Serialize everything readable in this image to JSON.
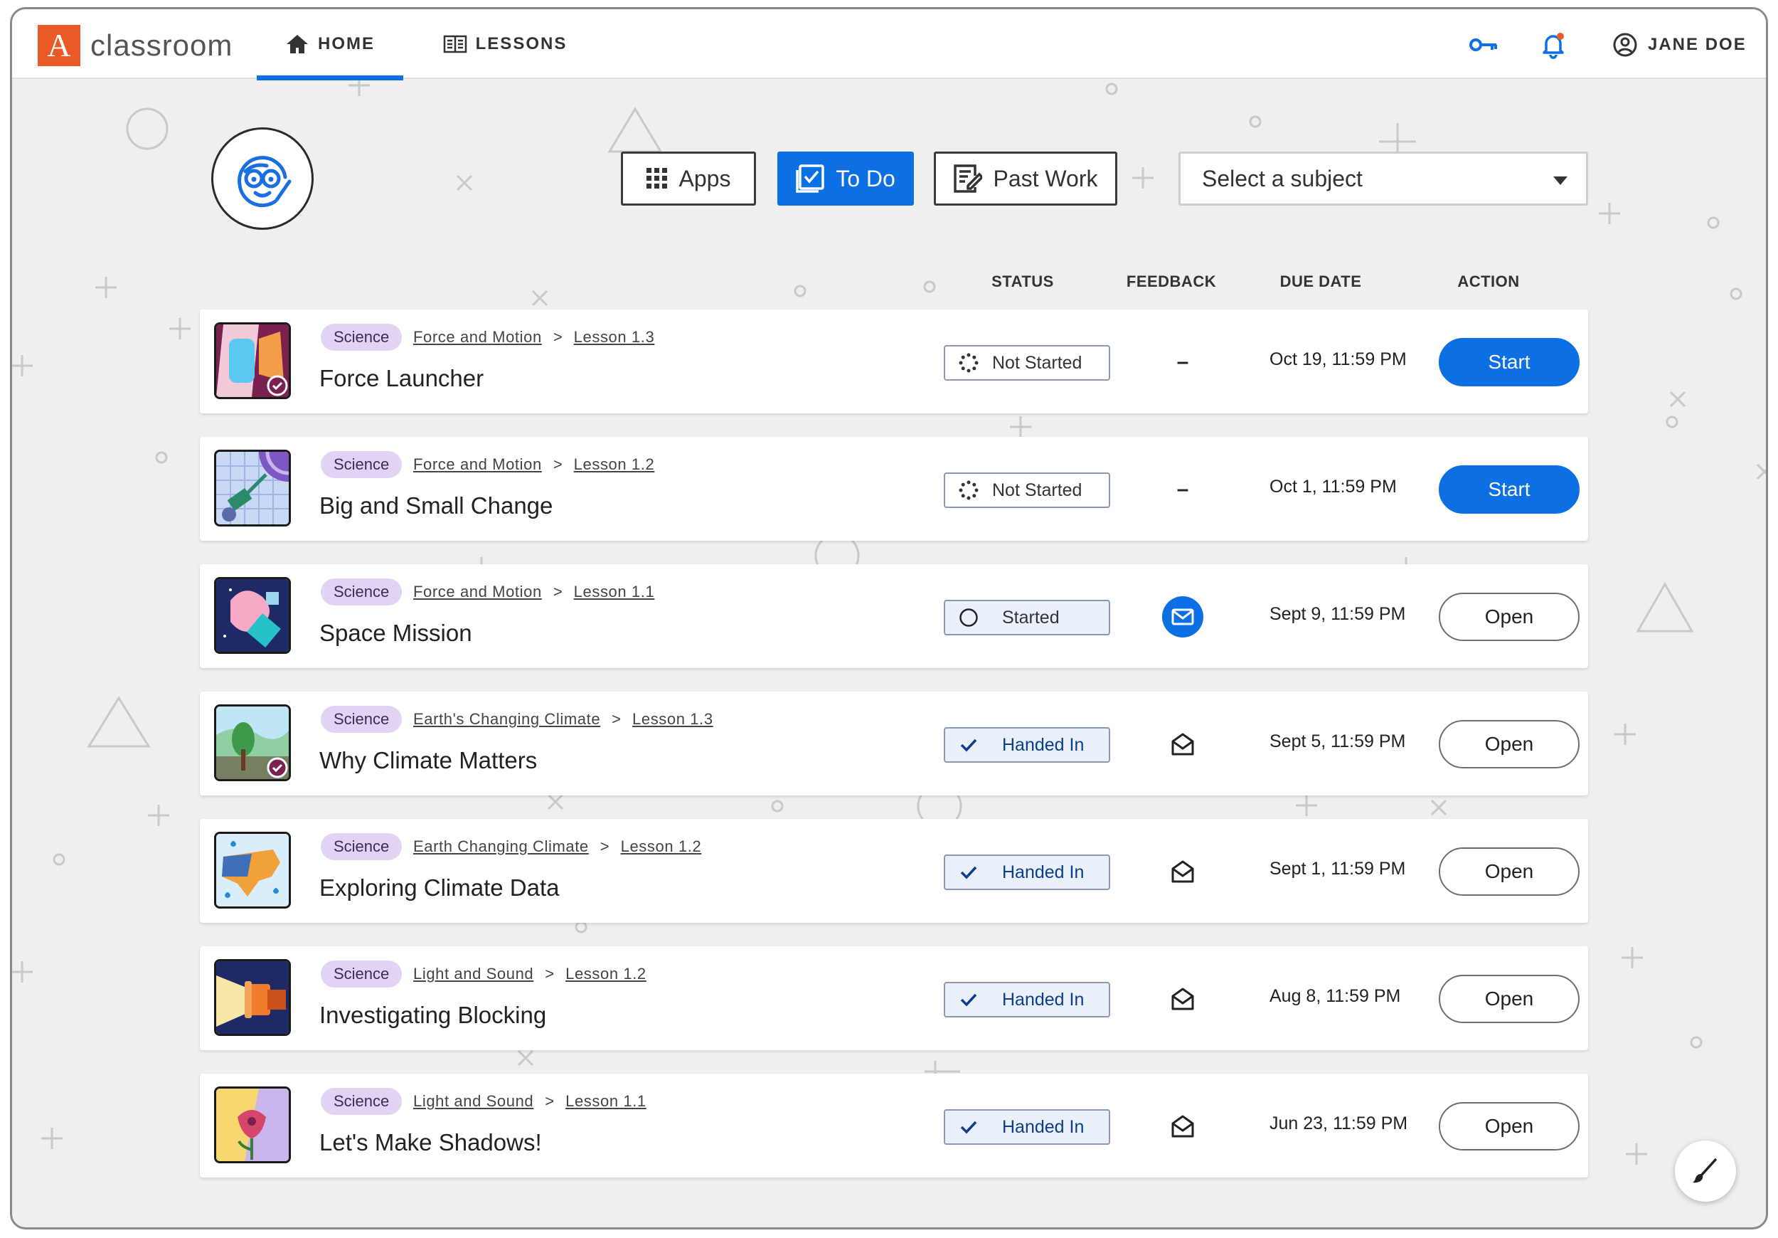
{
  "app": {
    "logo_letter": "A",
    "logo_text": "classroom",
    "brand_color": "#ea5a27",
    "accent_color": "#0c6fe3"
  },
  "nav": {
    "tabs": [
      {
        "label": "HOME",
        "icon": "home-icon",
        "active": true
      },
      {
        "label": "LESSONS",
        "icon": "book-icon",
        "active": false
      }
    ],
    "key_icon": "key-icon",
    "bell_icon": "bell-icon",
    "user_name": "JANE DOE"
  },
  "toolbar": {
    "apps_label": "Apps",
    "todo_label": "To Do",
    "past_work_label": "Past Work",
    "subject_placeholder": "Select a subject"
  },
  "columns": {
    "status": "STATUS",
    "feedback": "FEEDBACK",
    "due_date": "DUE DATE",
    "action": "ACTION"
  },
  "assignments": [
    {
      "subject": "Science",
      "unit": "Force and Motion",
      "lesson": "Lesson 1.3",
      "title": "Force Launcher",
      "status": "Not Started",
      "status_icon": "progress-dots-icon",
      "feedback": "–",
      "due": "Oct 19, 11:59 PM",
      "action": "Start"
    },
    {
      "subject": "Science",
      "unit": "Force and Motion",
      "lesson": "Lesson 1.2",
      "title": "Big and Small Change",
      "status": "Not Started",
      "status_icon": "progress-dots-icon",
      "feedback": "–",
      "due": "Oct 1, 11:59 PM",
      "action": "Start"
    },
    {
      "subject": "Science",
      "unit": "Force and Motion",
      "lesson": "Lesson 1.1",
      "title": "Space Mission",
      "status": "Started",
      "status_icon": "circle-icon",
      "feedback": "mail-new-icon",
      "due": "Sept 9, 11:59 PM",
      "action": "Open"
    },
    {
      "subject": "Science",
      "unit": "Earth's Changing Climate",
      "lesson": "Lesson 1.3",
      "title": "Why Climate Matters",
      "status": "Handed In",
      "status_icon": "check-icon",
      "feedback": "mail-open-icon",
      "due": "Sept 5, 11:59 PM",
      "action": "Open"
    },
    {
      "subject": "Science",
      "unit": "Earth Changing Climate",
      "lesson": "Lesson 1.2",
      "title": "Exploring Climate Data",
      "status": "Handed In",
      "status_icon": "check-icon",
      "feedback": "mail-open-icon",
      "due": "Sept 1, 11:59 PM",
      "action": "Open"
    },
    {
      "subject": "Science",
      "unit": "Light and Sound",
      "lesson": "Lesson 1.2",
      "title": "Investigating Blocking",
      "status": "Handed In",
      "status_icon": "check-icon",
      "feedback": "mail-open-icon",
      "due": "Aug 8, 11:59 PM",
      "action": "Open"
    },
    {
      "subject": "Science",
      "unit": "Light and Sound",
      "lesson": "Lesson 1.1",
      "title": "Let's Make Shadows!",
      "status": "Handed In",
      "status_icon": "check-icon",
      "feedback": "mail-open-icon",
      "due": "Jun 23, 11:59 PM",
      "action": "Open"
    }
  ],
  "crumb_separator": ">",
  "fab_icon": "paintbrush-icon"
}
